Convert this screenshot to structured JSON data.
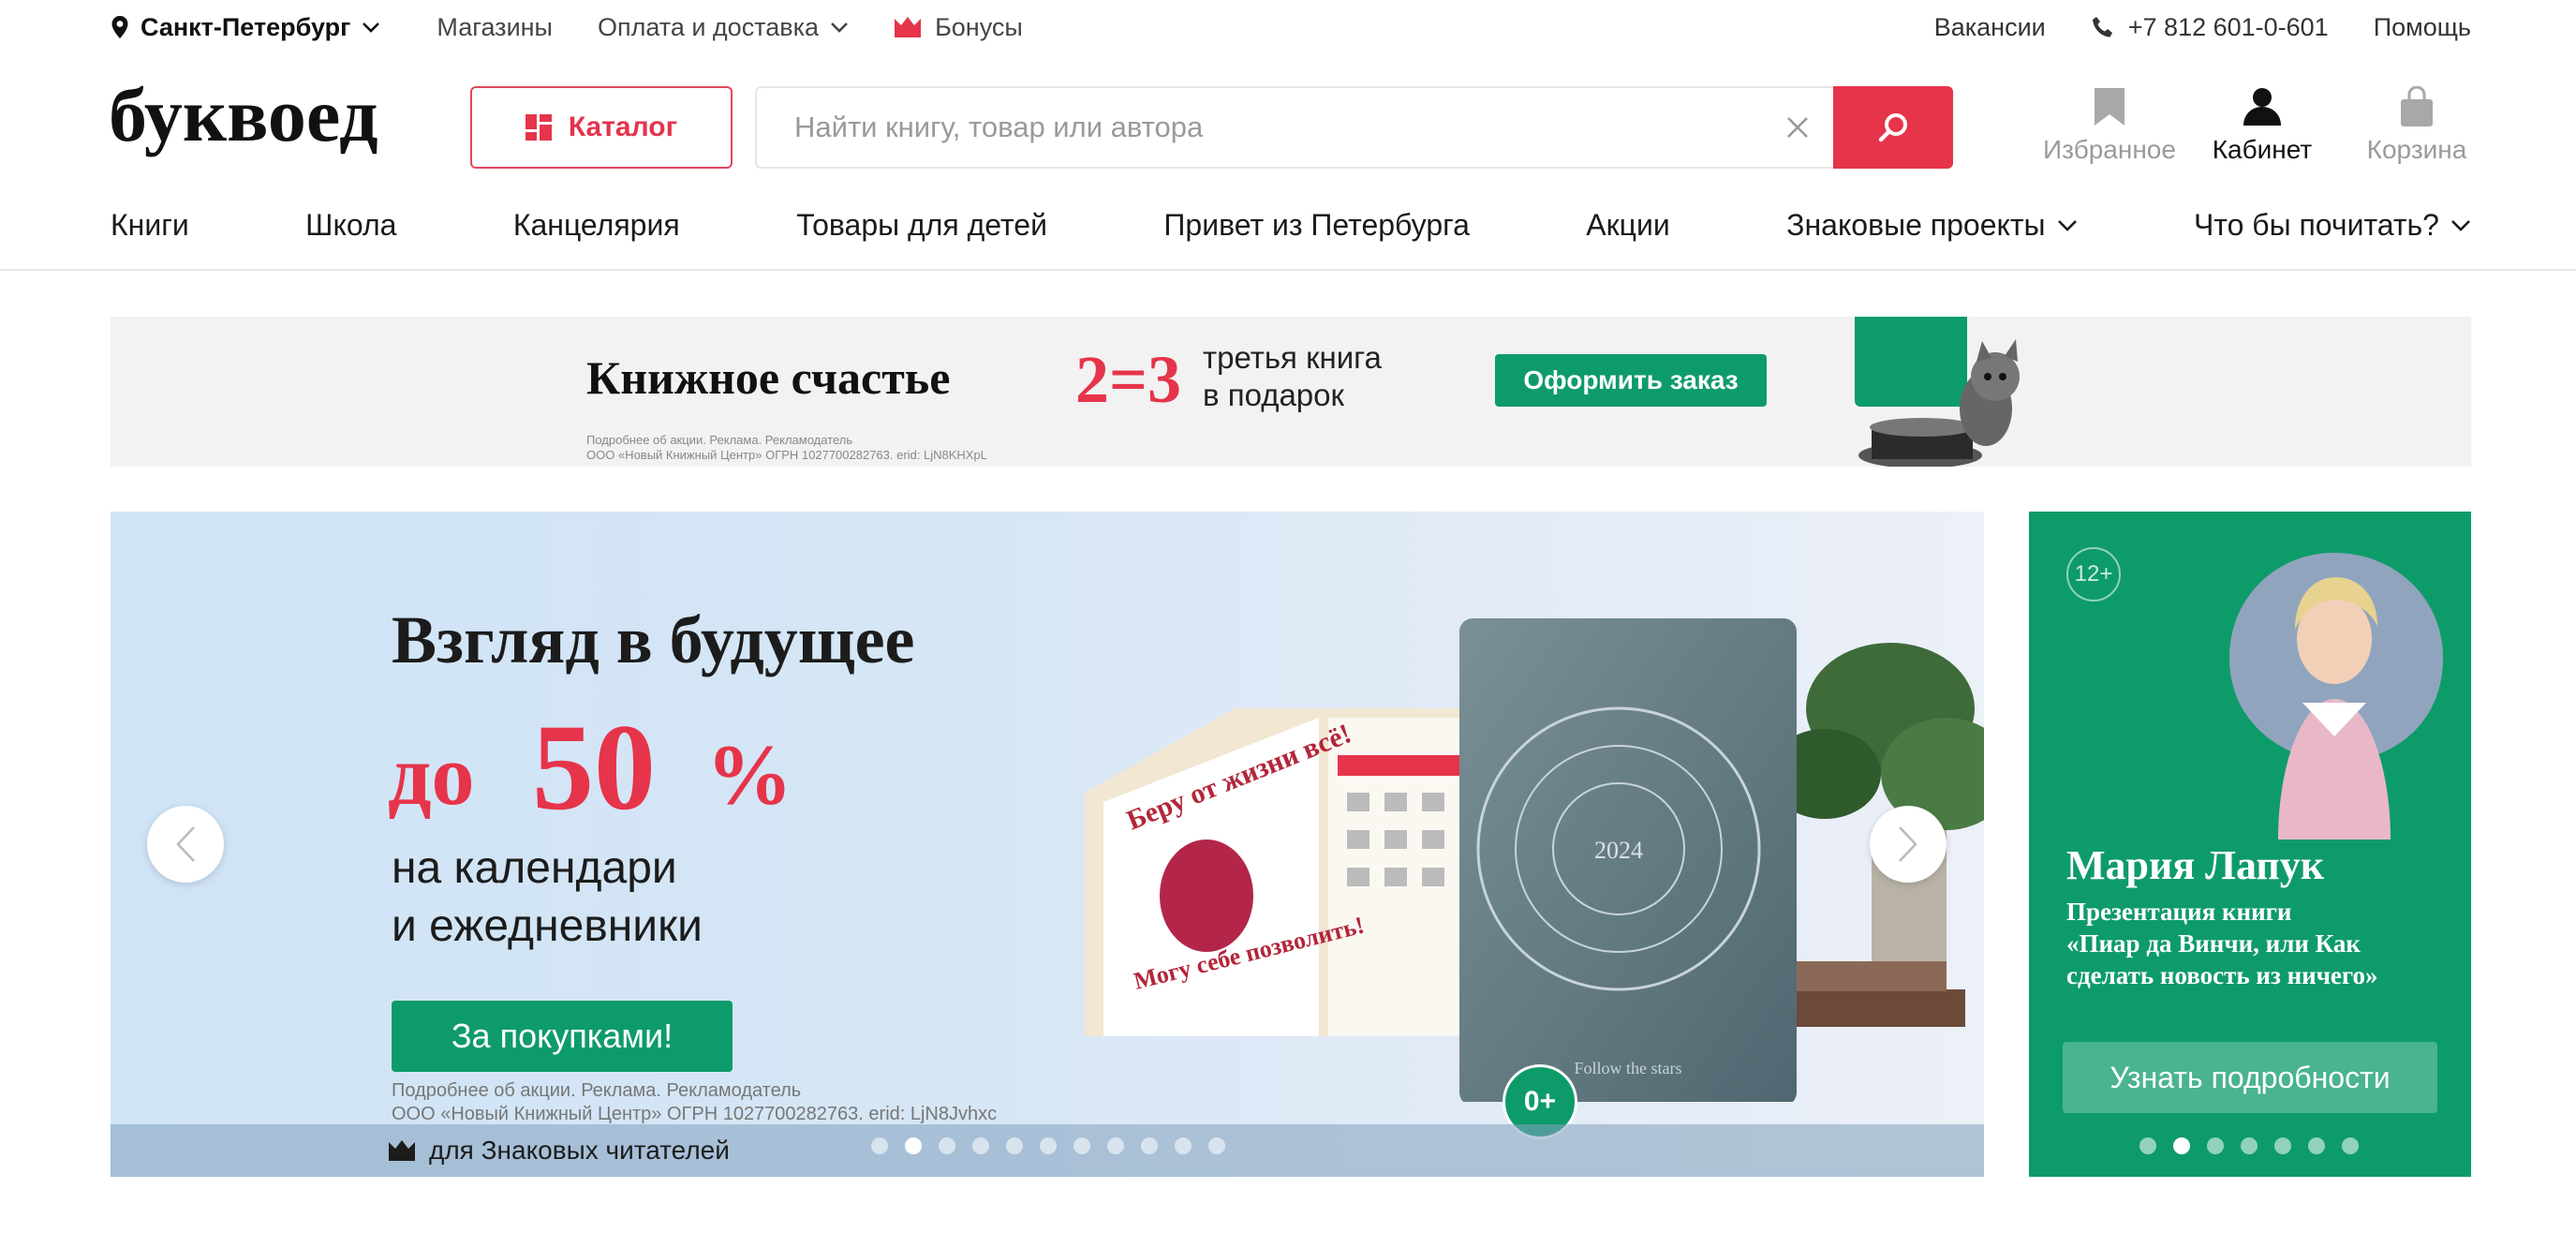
{
  "topbar": {
    "city": "Санкт-Петербург",
    "stores": "Магазины",
    "payment": "Оплата и доставка",
    "bonuses": "Бонусы",
    "vacancies": "Вакансии",
    "phone": "+7 812 601-0-601",
    "help": "Помощь"
  },
  "header": {
    "logo_text": "буквоед",
    "catalog_label": "Каталог",
    "search_placeholder": "Найти книгу, товар или автора",
    "favorites_label": "Избранное",
    "cabinet_label": "Кабинет",
    "cart_label": "Корзина"
  },
  "nav": {
    "items": [
      {
        "label": "Книги"
      },
      {
        "label": "Школа"
      },
      {
        "label": "Канцелярия"
      },
      {
        "label": "Товары для детей"
      },
      {
        "label": "Привет из Петербурга"
      },
      {
        "label": "Акции"
      },
      {
        "label": "Знаковые проекты"
      },
      {
        "label": "Что бы почитать?"
      }
    ]
  },
  "promo_strip": {
    "title": "Книжное счастье",
    "offer": "2=3",
    "offer_line1": "третья книга",
    "offer_line2": "в подарок",
    "button": "Оформить заказ",
    "fine_line1": "Подробнее об акции. Реклама. Рекламодатель",
    "fine_line2": "ООО «Новый Книжный Центр» ОГРН 1027700282763. erid: LjN8KHXpL"
  },
  "main_banner": {
    "title": "Взгляд в будущее",
    "discount_prefix": "до",
    "discount_value": "50",
    "discount_suffix": "%",
    "subtitle_line1": "на календари",
    "subtitle_line2": "и ежедневники",
    "cta": "За покупками!",
    "fine_line1": "Подробнее об акции. Реклама. Рекламодатель",
    "fine_line2": "ООО «Новый Книжный Центр» ОГРН 1027700282763. erid: LjN8Jvhxc",
    "footer_label": "для Знаковых читателей",
    "age_rating": "0+",
    "calendar_text_top": "Беру от жизни всё!",
    "calendar_text_bottom": "Могу себе позволить!",
    "planner_year": "2024",
    "planner_caption": "Follow the stars",
    "slide_count": 11,
    "active_slide": 2
  },
  "side_banner": {
    "age_rating": "12+",
    "name": "Мария Лапук",
    "desc_line1": "Презентация книги",
    "desc_line2": "«Пиар да Винчи, или Как",
    "desc_line3": "сделать новость из ничего»",
    "button": "Узнать подробности",
    "slide_count": 7,
    "active_slide": 2
  },
  "colors": {
    "brand_red": "#e6344a",
    "brand_green": "#0e9b6a"
  }
}
